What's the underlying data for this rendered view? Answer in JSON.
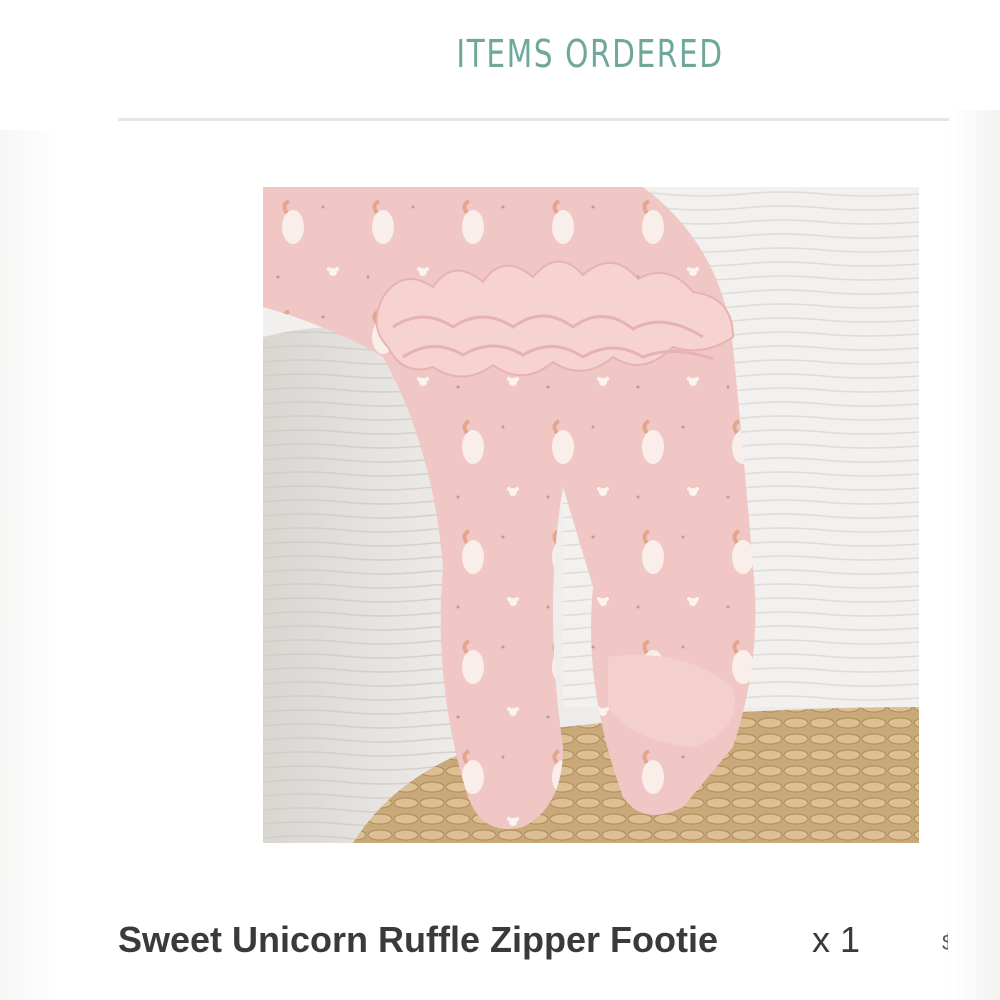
{
  "section": {
    "title": "ITEMS ORDERED"
  },
  "item": {
    "name": "Sweet Unicorn Ruffle Zipper Footie",
    "quantity": "x 1",
    "image_alt": "Pink unicorn print ruffle footie worn by baby climbing onto bed",
    "colors": {
      "accent": "#6fa89a",
      "text": "#3a3a3a"
    }
  }
}
